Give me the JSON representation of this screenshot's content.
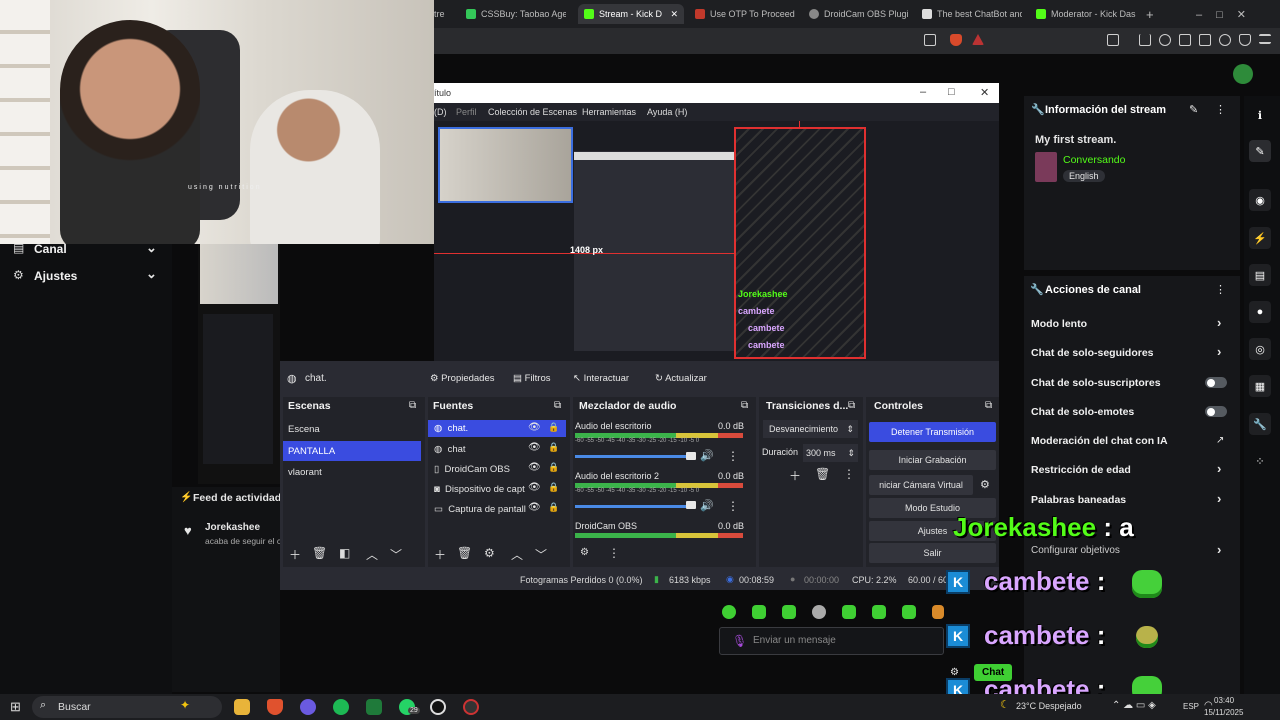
{
  "browser": {
    "tabs": [
      {
        "label": "tre",
        "color": "#444"
      },
      {
        "label": "CSSBuy: Taobao Agent",
        "color": "#34c759"
      },
      {
        "label": "Stream - Kick D",
        "color": "#53fc18",
        "active": true
      },
      {
        "label": "Use OTP To Proceed -",
        "color": "#c1392b"
      },
      {
        "label": "DroidCam OBS Plugin",
        "color": "#888"
      },
      {
        "label": "The best ChatBot and",
        "color": "#ddd"
      },
      {
        "label": "Moderator - Kick Dash",
        "color": "#53fc18"
      }
    ],
    "new_tab": "+"
  },
  "kick_left": {
    "canal": "Canal",
    "ajustes": "Ajustes",
    "feed_title": "Feed de actividades",
    "feed_user": "Jorekashee",
    "feed_action": "acaba de seguir el c",
    "webcam_caption": "using nutrition"
  },
  "stream_info": {
    "header": "Información del stream",
    "title": "My first stream.",
    "category": "Conversando",
    "language": "English"
  },
  "channel_actions": {
    "header": "Acciones de canal",
    "items": [
      "Modo lento",
      "Chat de solo-seguidores",
      "Chat de solo-suscriptores",
      "Chat de solo-emotes",
      "Moderación del chat con IA",
      "Restricción de edad",
      "Palabras baneadas",
      "Configurar objetivos"
    ]
  },
  "chat": {
    "placeholder": "Enviar un mensaje",
    "chat_button": "Chat",
    "overlay": [
      {
        "user": "Jorekashee",
        "sep": ":",
        "msg": "a",
        "color": "#53fc18"
      },
      {
        "user": "cambete",
        "sep": ":",
        "msg": "",
        "color": "#d9a6ff"
      },
      {
        "user": "cambete",
        "sep": ":",
        "msg": "",
        "color": "#d9a6ff"
      },
      {
        "user": "cambete",
        "sep": ":",
        "msg": "",
        "color": "#d9a6ff"
      }
    ]
  },
  "obs": {
    "title": "ítulo",
    "menu": [
      "(D)",
      "Perfil",
      "Colección de Escenas",
      "Herramientas",
      "Ayuda (H)"
    ],
    "preview_label": "1408 px",
    "source_name": "chat.",
    "toolbar": [
      "Propiedades",
      "Filtros",
      "Interactuar",
      "Actualizar"
    ],
    "docks": {
      "scenes": "Escenas",
      "sources": "Fuentes",
      "mixer": "Mezclador de audio",
      "transitions": "Transiciones d...",
      "controls": "Controles"
    },
    "scenes": [
      "Escena",
      "PANTALLA",
      "vlaorant"
    ],
    "sources": [
      "chat.",
      "chat",
      "DroidCam OBS",
      "Dispositivo de capt",
      "Captura de pantall"
    ],
    "mixer": [
      {
        "name": "Audio del escritorio",
        "db": "0.0 dB"
      },
      {
        "name": "Audio del escritorio 2",
        "db": "0.0 dB"
      },
      {
        "name": "DroidCam OBS",
        "db": "0.0 dB"
      }
    ],
    "meter_scale": "-60 -55 -50 -45 -40 -35 -30 -25 -20 -15 -10 -5 0",
    "transition": "Desvanecimiento",
    "duration_label": "Duración",
    "duration_value": "300 ms",
    "controls": [
      "Detener Transmisión",
      "Iniciar Grabación",
      "niciar Cámara Virtual",
      "Modo Estudio",
      "Ajustes",
      "Salir"
    ],
    "status": {
      "dropped": "Fotogramas Perdidos 0 (0.0%)",
      "bitrate": "6183 kbps",
      "stream_time": "00:08:59",
      "rec_time": "00:00:00",
      "cpu": "CPU: 2.2%",
      "fps": "60.00 / 60"
    }
  },
  "taskbar": {
    "search": "Buscar",
    "weather": "23°C  Despejado",
    "lang": "ESP",
    "time": "03:40",
    "date": "15/11/2025",
    "badge": "29"
  }
}
